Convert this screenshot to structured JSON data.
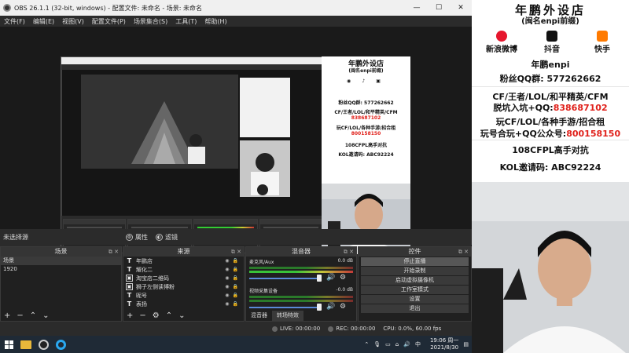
{
  "obs": {
    "window_title": "OBS 26.1.1 (32-bit, windows) - 配置文件: 未命名 - 场景: 未命名",
    "menu": [
      "文件(F)",
      "编辑(E)",
      "视图(V)",
      "配置文件(P)",
      "场景集合(S)",
      "工具(T)",
      "帮助(H)"
    ],
    "no_source_selected": "未选择源",
    "properties_label": "属性",
    "filters_label": "滤镜",
    "scenes": {
      "title": "场景",
      "items": [
        "场景",
        "1920"
      ]
    },
    "sources": {
      "title": "来源",
      "items": [
        {
          "icon": "text-icon",
          "label": "年鹏店"
        },
        {
          "icon": "text-icon",
          "label": "耀化二"
        },
        {
          "icon": "image-icon",
          "label": "淘宝店二维码"
        },
        {
          "icon": "image-icon",
          "label": "狮子左侧读博粉"
        },
        {
          "icon": "text-icon",
          "label": "昵号"
        },
        {
          "icon": "text-icon",
          "label": "表扬"
        }
      ]
    },
    "mixer": {
      "title": "混音器",
      "channels": [
        {
          "name": "麦克风/Aux",
          "db": "0.0 dB"
        },
        {
          "name": "视频采集设备",
          "db": "-0.0 dB"
        }
      ],
      "tabs": [
        "混音器",
        "转场特效"
      ]
    },
    "controls": {
      "title": "控件",
      "buttons": [
        "停止直播",
        "开始录制",
        "启动虚拟摄像机",
        "工作室模式",
        "设置",
        "退出"
      ]
    },
    "status": {
      "live": "LIVE: 00:00:00",
      "rec": "REC: 00:00:00",
      "cpu": "CPU: 0.0%, 60.00 fps"
    }
  },
  "taskbar": {
    "clock_time": "19:06 周一",
    "clock_date": "2021/8/30"
  },
  "store": {
    "title": "年鹏外设店",
    "subtitle": "(闽名enpi前缀)",
    "socials": [
      {
        "label": "新浪微博",
        "color": "#e6162d",
        "icon": "weibo-icon"
      },
      {
        "label": "抖音",
        "color": "#111111",
        "icon": "douyin-icon"
      },
      {
        "label": "快手",
        "color": "#ff7a00",
        "icon": "kuaishou-icon"
      }
    ],
    "handle": "年鹏enpi",
    "fan_qq": "粉丝QQ群: 577262662",
    "games_line": "CF/王者/LOL/和平精英/CFM",
    "cheat_label": "脱坑入坑+QQ:",
    "cheat_qq": "838687102",
    "games_line2": "玩CF/LOL/各种手游/招合租",
    "wechat_label": "玩号合玩+QQ公众号:",
    "wechat_qq": "800158150",
    "match_line": "108CFPL高手对抗",
    "kol_line": "KOL邀请码: ABC92224"
  }
}
